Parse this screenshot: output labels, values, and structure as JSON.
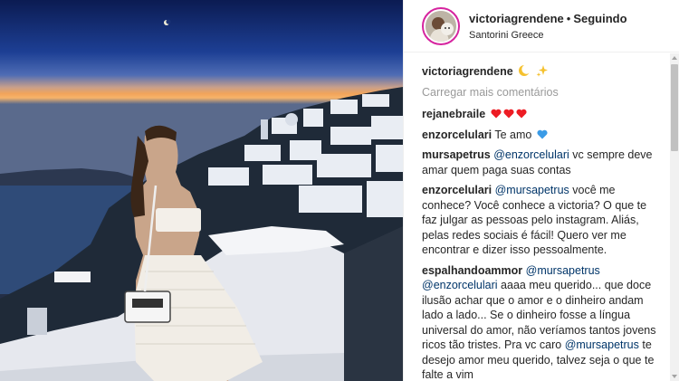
{
  "header": {
    "username": "victoriagrendene",
    "separator": "•",
    "follow_status": "Seguindo",
    "location": "Santorini Greece"
  },
  "caption": {
    "username": "victoriagrendene",
    "emojis": [
      "crescent-moon-icon",
      "sparkles-icon"
    ]
  },
  "load_more": "Carregar mais comentários",
  "comments": [
    {
      "username": "rejanebraile",
      "text": "",
      "icons": [
        "red-heart-icon",
        "red-heart-icon",
        "red-heart-icon"
      ]
    },
    {
      "username": "enzorcelulari",
      "text": "Te amo",
      "icons": [
        "blue-heart-icon"
      ]
    },
    {
      "username": "mursapetrus",
      "mention": "@enzorcelulari",
      "text": "vc sempre deve amar quem paga suas contas"
    },
    {
      "username": "enzorcelulari",
      "mention": "@mursapetrus",
      "text": "você me conhece? Você conhece a victoria? O que te faz julgar as pessoas pelo instagram. Aliás, pelas redes sociais é fácil! Quero ver me encontrar e dizer isso pessoalmente."
    },
    {
      "username": "espalhandoammor",
      "mention": "@mursapetrus",
      "mention2": "@enzorcelulari",
      "text": "aaaa meu querido... que doce ilusão achar que o amor e o dinheiro andam lado a lado... Se o dinheiro fosse a língua universal do amor, não veríamos tantos jovens ricos tão tristes. Pra vc caro",
      "mention3": "@mursapetrus",
      "text2": "te desejo amor meu querido, talvez seja o que te falte a vim"
    }
  ],
  "colors": {
    "link": "#003569",
    "muted": "#999999",
    "heart_red": "#ed1c24",
    "heart_blue": "#3b9be6",
    "story_ring": "#d6249f"
  }
}
